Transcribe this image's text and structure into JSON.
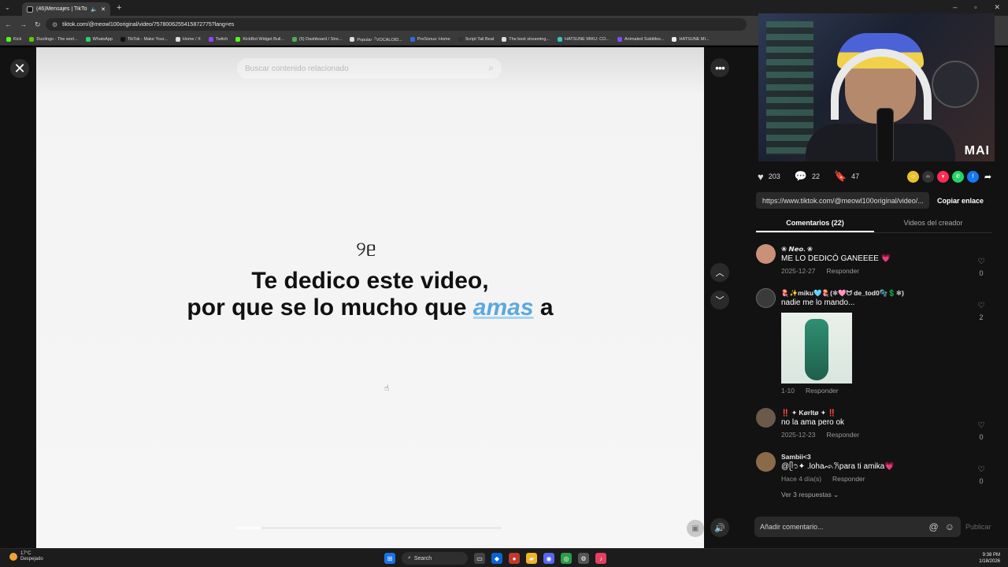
{
  "browser": {
    "tab_title": "(46)Mensajes | TikTok",
    "url": "tiktok.com/@meowl100original/video/7578006255415872775?lang=es",
    "bookmarks": [
      {
        "label": "Kick",
        "color": "#53fc18"
      },
      {
        "label": "Duolingo - The worl...",
        "color": "#58cc02"
      },
      {
        "label": "WhatsApp",
        "color": "#25d366"
      },
      {
        "label": "TikTok - Make Your...",
        "color": "#111111"
      },
      {
        "label": "Home / X",
        "color": "#dddddd"
      },
      {
        "label": "Twitch",
        "color": "#9146ff"
      },
      {
        "label": "KickBot Widget Buil...",
        "color": "#53fc18"
      },
      {
        "label": "(5) Dashboard / Stre...",
        "color": "#4caf50"
      },
      {
        "label": "Popular「VOCALOID...",
        "color": "#dddddd"
      },
      {
        "label": "PreSonus: Home",
        "color": "#2d6ee0"
      },
      {
        "label": "Script Tail Beat",
        "color": "#333333"
      },
      {
        "label": "The best streaming...",
        "color": "#dddddd"
      },
      {
        "label": "HATSUNE MIKU: CO...",
        "color": "#39c5bb"
      },
      {
        "label": "Animated Subtitles...",
        "color": "#7c4dff"
      },
      {
        "label": "HATSUNE MI...",
        "color": "#eeeeee"
      }
    ]
  },
  "video": {
    "search_placeholder": "Buscar contenido relacionado",
    "glyph": "୨ᥱ",
    "caption_line1": "Te dedico este video,",
    "caption_line2_pre": "por que se lo mucho que ",
    "caption_highlight": "amas",
    "caption_line2_post": " a",
    "progress": 0.09
  },
  "stats": {
    "likes": "203",
    "comments": "22",
    "saves": "47"
  },
  "link": {
    "url": "https://www.tiktok.com/@meowl100original/video/...",
    "copy_label": "Copiar enlace"
  },
  "tabs": {
    "comments": "Comentarios (22)",
    "creator_videos": "Videos del creador"
  },
  "comments": [
    {
      "user": "❀ 𝙉𝙚𝙤. ❀",
      "text": "ME LO DEDICÓ GANEEEE 💗",
      "date": "2025-12-27",
      "reply": "Responder",
      "likes": "0",
      "avatar": "#c9907a"
    },
    {
      "user": "🪼✨miku🩵🪼(✻🩷ᗢ de_tod0🫧💲✻)",
      "text": "nadie me lo mando...",
      "date": "1-10",
      "reply": "Responder",
      "likes": "2",
      "avatar": "#3a3a3a",
      "has_image": true
    },
    {
      "user": "‼️ ✦ Kørltø ✦ ‼️",
      "text": "no la ama pero ok",
      "date": "2025-12-23",
      "reply": "Responder",
      "likes": "0",
      "avatar": "#6a5a4a"
    },
    {
      "user": "Sambii<3",
      "text": "@ᥫ᭡✦ .lohaᨒ𐙚para ti amika💗",
      "date": "Hace 4 día(s)",
      "reply": "Responder",
      "likes": "0",
      "avatar": "#8b6a4a",
      "more": "Ver 3 respuestas ⌄"
    }
  ],
  "add_comment": {
    "placeholder": "Añadir comentario...",
    "publish": "Publicar"
  },
  "taskbar": {
    "temp": "17°C",
    "weather": "Despejado",
    "search": "Search",
    "time": "9:38 PM",
    "date": "1/18/2026"
  },
  "webcam": {
    "logo": "MAI"
  }
}
